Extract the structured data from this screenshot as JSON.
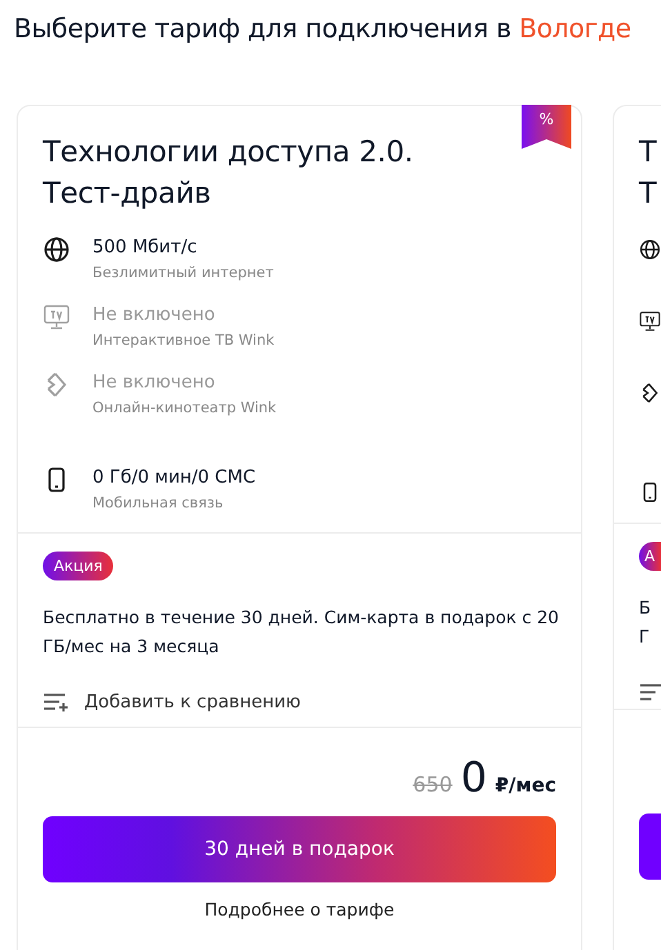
{
  "heading": {
    "text": "Выберите тариф для подключения в ",
    "city": "Вологде"
  },
  "card": {
    "title": "Технологии доступа 2.0. Тест-драйв",
    "ribbon": "%",
    "features": [
      {
        "kind": "internet",
        "value": "500 Мбит/с",
        "caption": "Безлимитный интернет",
        "included": true
      },
      {
        "kind": "tv",
        "value": "Не включено",
        "caption": "Интерактивное ТВ Wink",
        "included": false
      },
      {
        "kind": "cinema",
        "value": "Не включено",
        "caption": "Онлайн-кинотеатр Wink",
        "included": false
      },
      {
        "kind": "mobile",
        "value": "0 Гб/0 мин/0 СМС",
        "caption": "Мобильная связь",
        "included": true
      }
    ],
    "promo_badge": "Акция",
    "promo_text": "Бесплатно в течение 30 дней. Сим-карта в подарок с 20 ГБ/мес на 3 месяца",
    "compare": "Добавить к сравнению",
    "old_price": "650",
    "price": "0",
    "unit": "₽/мес",
    "button": "30 дней в подарок",
    "details": "Подробнее о тарифе"
  },
  "next_card": {
    "title_lines": [
      "Т",
      "Т"
    ],
    "features": [
      {
        "kind": "internet",
        "included": true
      },
      {
        "kind": "tv",
        "included": true
      },
      {
        "kind": "cinema",
        "included": true
      },
      {
        "kind": "mobile",
        "included": true
      }
    ],
    "promo_badge": "А",
    "promo_text_lines": [
      "Б",
      "Г"
    ]
  }
}
